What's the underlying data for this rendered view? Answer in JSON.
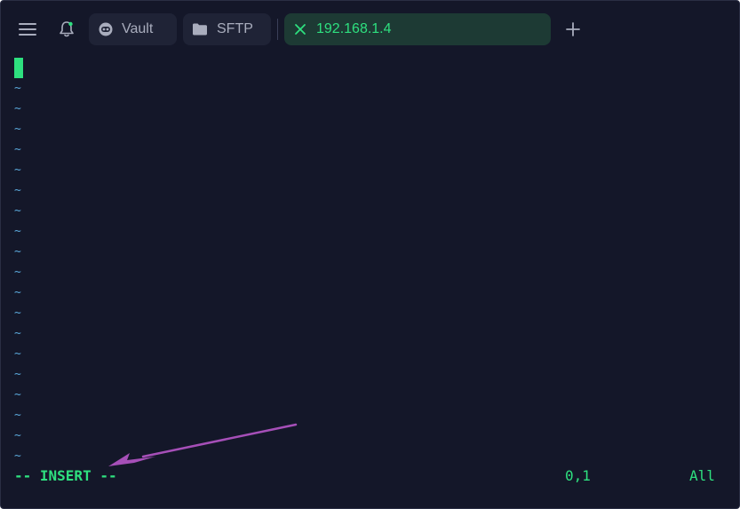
{
  "topbar": {
    "menu_icon": "hamburger-menu-icon",
    "bell_icon": "bell-icon",
    "tabs": [
      {
        "label": "Vault",
        "icon": "vault-icon",
        "active": false
      },
      {
        "label": "SFTP",
        "icon": "folder-icon",
        "active": false
      },
      {
        "label": "192.168.1.4",
        "icon": "close-icon",
        "active": true
      }
    ],
    "add_icon": "plus-icon"
  },
  "terminal": {
    "empty_line_marker": "~",
    "empty_line_count": 19,
    "status": {
      "mode": "-- INSERT --",
      "position": "0,1",
      "scope": "All"
    }
  },
  "colors": {
    "background": "#141729",
    "tab_background": "#1f2336",
    "active_tab_background": "#1d3a34",
    "accent_green": "#2ee07f",
    "tilde_blue": "#5aa7d9",
    "annotation_arrow": "#a64fb8"
  }
}
